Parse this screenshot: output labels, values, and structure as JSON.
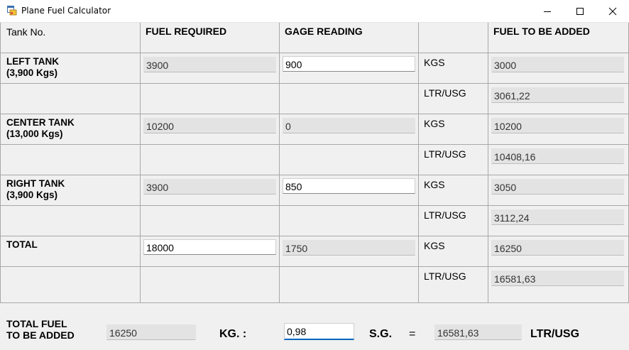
{
  "window": {
    "title": "Plane Fuel Calculator"
  },
  "headers": {
    "tank_no": "Tank No.",
    "fuel_required": "FUEL REQUIRED",
    "gage_reading": "GAGE READING",
    "unit": "",
    "fuel_to_be_added": "FUEL TO BE ADDED"
  },
  "rows": [
    {
      "label_line1": "LEFT TANK",
      "label_line2": "(3,900 Kgs)",
      "fuel_required": "3900",
      "gage_reading": "900",
      "kgs_label": "KGS",
      "kgs_value": "3000",
      "ltr_label": "LTR/USG",
      "ltr_value": "3061,22"
    },
    {
      "label_line1": "CENTER TANK",
      "label_line2": "(13,000 Kgs)",
      "fuel_required": "10200",
      "gage_reading": "0",
      "kgs_label": "KGS",
      "kgs_value": "10200",
      "ltr_label": "LTR/USG",
      "ltr_value": "10408,16"
    },
    {
      "label_line1": "RIGHT TANK",
      "label_line2": "(3,900 Kgs)",
      "fuel_required": "3900",
      "gage_reading": "850",
      "kgs_label": "KGS",
      "kgs_value": "3050",
      "ltr_label": "LTR/USG",
      "ltr_value": "3112,24"
    },
    {
      "label_line1": "TOTAL",
      "label_line2": "",
      "fuel_required": "18000",
      "gage_reading": "1750",
      "kgs_label": "KGS",
      "kgs_value": "16250",
      "ltr_label": "LTR/USG",
      "ltr_value": "16581,63"
    }
  ],
  "footer": {
    "total_label_line1": "TOTAL FUEL",
    "total_label_line2": "TO BE ADDED",
    "total_value": "16250",
    "kg_label": "KG. :",
    "sg_value": "0,98",
    "sg_label": "S.G.",
    "equals": "=",
    "result_value": "16581,63",
    "result_unit": "LTR/USG"
  }
}
